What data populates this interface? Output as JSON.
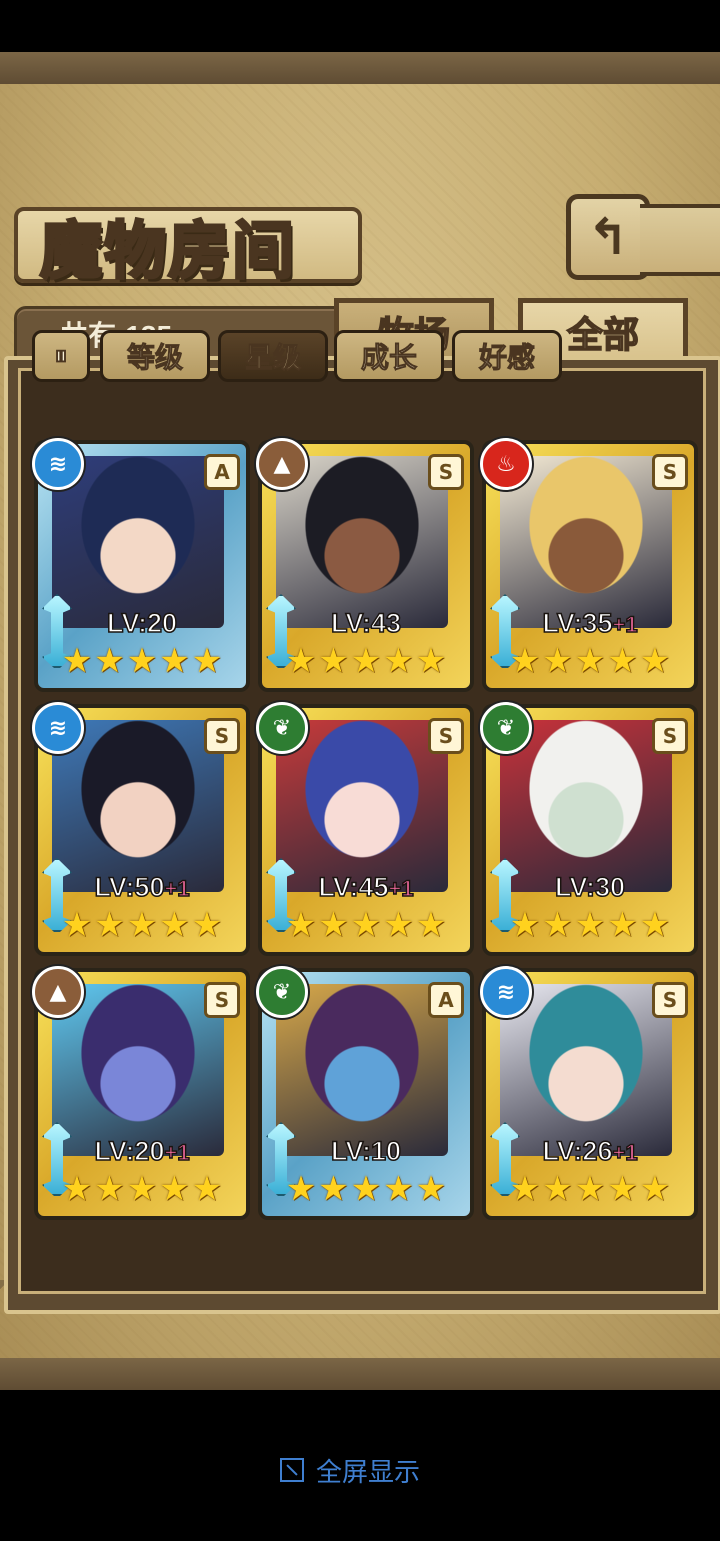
{
  "title": "魔物房间",
  "back_icon": "back-arrow-icon",
  "count_label": "共有:135",
  "tabs": [
    {
      "label": "牧场",
      "active": false
    },
    {
      "label": "全部",
      "active": true
    }
  ],
  "filters": {
    "sort_icon": "sort-toggle-icon",
    "items": [
      {
        "label": "等级",
        "active": false
      },
      {
        "label": "星级",
        "active": true
      },
      {
        "label": "成长",
        "active": false
      },
      {
        "label": "好感",
        "active": false
      }
    ]
  },
  "monsters": [
    {
      "element": "water",
      "rank": "A",
      "frame": "blue",
      "level": "LV:20",
      "plus": "",
      "stars": 5,
      "colors": [
        "#1e2b55",
        "#f3d8c6",
        "#2e3d7a"
      ]
    },
    {
      "element": "earth",
      "rank": "S",
      "frame": "gold",
      "level": "LV:43",
      "plus": "",
      "stars": 5,
      "colors": [
        "#1c1c24",
        "#8b5a42",
        "#d9d4c8"
      ]
    },
    {
      "element": "fire",
      "rank": "S",
      "frame": "gold",
      "level": "LV:35",
      "plus": "+1",
      "stars": 5,
      "colors": [
        "#e9c66a",
        "#8a5a3a",
        "#f4ead4"
      ]
    },
    {
      "element": "water",
      "rank": "S",
      "frame": "gold",
      "level": "LV:50",
      "plus": "+1",
      "stars": 5,
      "colors": [
        "#1a1a28",
        "#f2d2c2",
        "#3e79b8"
      ]
    },
    {
      "element": "wood",
      "rank": "S",
      "frame": "gold",
      "level": "LV:45",
      "plus": "+1",
      "stars": 5,
      "colors": [
        "#3a4aa8",
        "#f8dcd6",
        "#c63a3a"
      ]
    },
    {
      "element": "wood",
      "rank": "S",
      "frame": "gold",
      "level": "LV:30",
      "plus": "",
      "stars": 5,
      "colors": [
        "#f1f1ee",
        "#cfe0d0",
        "#c8323a"
      ]
    },
    {
      "element": "earth",
      "rank": "S",
      "frame": "gold",
      "level": "LV:20",
      "plus": "+1",
      "stars": 5,
      "colors": [
        "#3a2d6e",
        "#7a86d8",
        "#5fc8f0"
      ]
    },
    {
      "element": "wood",
      "rank": "A",
      "frame": "blue",
      "level": "LV:10",
      "plus": "",
      "stars": 5,
      "colors": [
        "#4a2a5e",
        "#5fa2d8",
        "#d7a84a"
      ]
    },
    {
      "element": "water",
      "rank": "S",
      "frame": "gold",
      "level": "LV:26",
      "plus": "+1",
      "stars": 5,
      "colors": [
        "#2f8c9a",
        "#f4dcd0",
        "#e8e8f0"
      ]
    }
  ],
  "fullscreen_label": "全屏显示"
}
